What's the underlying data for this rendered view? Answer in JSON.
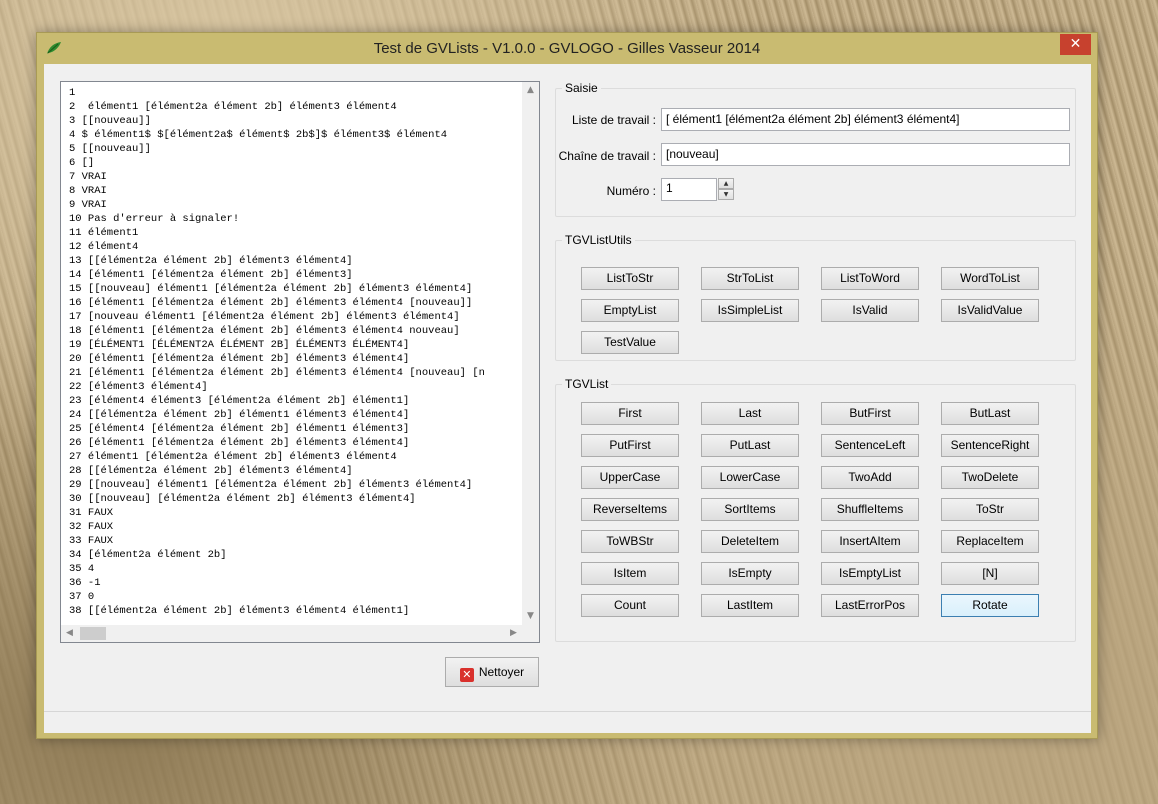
{
  "window": {
    "title": "Test de GVLists - V1.0.0 - GVLOGO - Gilles Vasseur 2014",
    "close_glyph": "✕"
  },
  "memo": {
    "lines": [
      "1",
      "2  élément1 [élément2a élément 2b] élément3 élément4",
      "3 [[nouveau]]",
      "4 $ élément1$ $[élément2a$ élément$ 2b$]$ élément3$ élément4",
      "5 [[nouveau]]",
      "6 []",
      "7 VRAI",
      "8 VRAI",
      "9 VRAI",
      "10 Pas d'erreur à signaler!",
      "11 élément1",
      "12 élément4",
      "13 [[élément2a élément 2b] élément3 élément4]",
      "14 [élément1 [élément2a élément 2b] élément3]",
      "15 [[nouveau] élément1 [élément2a élément 2b] élément3 élément4]",
      "16 [élément1 [élément2a élément 2b] élément3 élément4 [nouveau]]",
      "17 [nouveau élément1 [élément2a élément 2b] élément3 élément4]",
      "18 [élément1 [élément2a élément 2b] élément3 élément4 nouveau]",
      "19 [ÉLÉMENT1 [ÉLÉMENT2A ÉLÉMENT 2B] ÉLÉMENT3 ÉLÉMENT4]",
      "20 [élément1 [élément2a élément 2b] élément3 élément4]",
      "21 [élément1 [élément2a élément 2b] élément3 élément4 [nouveau] [n",
      "22 [élément3 élément4]",
      "23 [élément4 élément3 [élément2a élément 2b] élément1]",
      "24 [[élément2a élément 2b] élément1 élément3 élément4]",
      "25 [élément4 [élément2a élément 2b] élément1 élément3]",
      "26 [élément1 [élément2a élément 2b] élément3 élément4]",
      "27 élément1 [élément2a élément 2b] élément3 élément4",
      "28 [[élément2a élément 2b] élément3 élément4]",
      "29 [[nouveau] élément1 [élément2a élément 2b] élément3 élément4]",
      "30 [[nouveau] [élément2a élément 2b] élément3 élément4]",
      "31 FAUX",
      "32 FAUX",
      "33 FAUX",
      "34 [élément2a élément 2b]",
      "35 4",
      "36 -1",
      "37 0",
      "38 [[élément2a élément 2b] élément3 élément4 élément1]"
    ]
  },
  "clean_button": {
    "label": "Nettoyer"
  },
  "saisie": {
    "title": "Saisie",
    "liste_label": "Liste de travail :",
    "liste_value": "[ élément1 [élément2a élément 2b] élément3 élément4]",
    "chaine_label": "Chaîne de travail :",
    "chaine_value": "[nouveau]",
    "numero_label": "Numéro :",
    "numero_value": "1"
  },
  "utils": {
    "title": "TGVListUtils",
    "buttons": [
      "ListToStr",
      "StrToList",
      "ListToWord",
      "WordToList",
      "EmptyList",
      "IsSimpleList",
      "IsValid",
      "IsValidValue",
      "TestValue"
    ]
  },
  "list": {
    "title": "TGVList",
    "buttons": [
      "First",
      "Last",
      "ButFirst",
      "ButLast",
      "PutFirst",
      "PutLast",
      "SentenceLeft",
      "SentenceRight",
      "UpperCase",
      "LowerCase",
      "TwoAdd",
      "TwoDelete",
      "ReverseItems",
      "SortItems",
      "ShuffleItems",
      "ToStr",
      "ToWBStr",
      "DeleteItem",
      "InsertAItem",
      "ReplaceItem",
      "IsItem",
      "IsEmpty",
      "IsEmptyList",
      "[N]",
      "Count",
      "LastItem",
      "LastErrorPos",
      "Rotate"
    ]
  },
  "colors": {
    "frame": "#c9bb71",
    "close": "#c7412e",
    "focus": "#3c7fb1"
  }
}
